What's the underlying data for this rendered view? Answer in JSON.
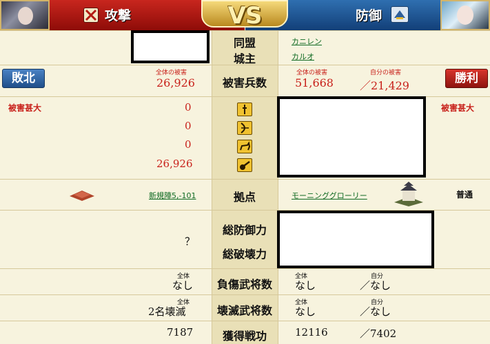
{
  "header": {
    "attack_label": "攻撃",
    "defense_label": "防御",
    "vs_label": "VS"
  },
  "rows": {
    "alliance_label": "同盟",
    "lord_label": "城主",
    "alliance_value": "カニレン",
    "lord_value": "カルオ"
  },
  "damage": {
    "label": "被害兵数",
    "attacker_total_caption": "全体の被害",
    "attacker_total": "26,926",
    "defender_total_caption": "全体の被害",
    "defender_total": "51,668",
    "defender_self_caption": "自分の被害",
    "defender_self": "／21,429",
    "result_left": "敗北",
    "result_right": "勝利"
  },
  "units": {
    "left_status": "被害甚大",
    "right_status": "被害甚大",
    "values": [
      "0",
      "0",
      "0",
      "26,926"
    ],
    "icons": [
      "spear-unit-icon",
      "bow-unit-icon",
      "cavalry-unit-icon",
      "siege-unit-icon"
    ]
  },
  "base": {
    "label": "拠点",
    "left_link": "新規陣5,-101",
    "right_link": "モーニンググローリー",
    "right_status": "普通"
  },
  "defense": {
    "total_defense_label": "総防御力",
    "total_destroy_label": "総破壊力",
    "left_value": "？"
  },
  "injured": {
    "label": "負傷武将数",
    "total_caption": "全体",
    "self_caption": "自分",
    "left_total": "なし",
    "right_total": "なし",
    "right_self": "／なし"
  },
  "destroyed": {
    "label": "壊滅武将数",
    "total_caption": "全体",
    "self_caption": "自分",
    "left_total": "2名壊滅",
    "right_total": "なし",
    "right_self": "／なし"
  },
  "merit": {
    "label": "獲得戦功",
    "left_value": "7187",
    "right_value": "12116",
    "right_self": "／7402"
  },
  "colors": {
    "attack_red": "#c8261e",
    "defense_blue": "#2f6fb0",
    "lose_blue": "#2b5f9e",
    "win_red": "#b81f1a",
    "text_red": "#c8211b",
    "link_green": "#0f6a22"
  }
}
